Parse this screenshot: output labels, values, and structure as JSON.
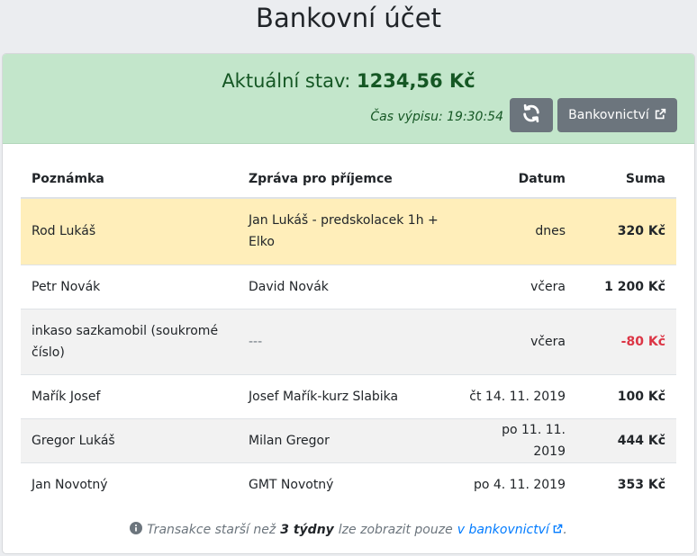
{
  "page": {
    "title": "Bankovní účet"
  },
  "balance": {
    "label": "Aktuální stav:",
    "value": "1234,56 Kč",
    "statement_time": "Čas výpisu: 19:30:54"
  },
  "buttons": {
    "refresh_icon": "refresh-icon",
    "bank_label": "Bankovnictví",
    "bank_icon": "external-link-icon"
  },
  "table": {
    "columns": [
      "Poznámka",
      "Zpráva pro příjemce",
      "Datum",
      "Suma"
    ],
    "rows": [
      {
        "note": "Rod Lukáš",
        "message": "Jan Lukáš - predskolacek 1h + Elko",
        "date": "dnes",
        "amount": "320 Kč",
        "highlight": true,
        "negative": false,
        "muted": false
      },
      {
        "note": "Petr Novák",
        "message": "David Novák",
        "date": "včera",
        "amount": "1 200 Kč",
        "highlight": false,
        "negative": false,
        "muted": false
      },
      {
        "note": "inkaso sazkamobil (soukromé číslo)",
        "message": "---",
        "date": "včera",
        "amount": "-80 Kč",
        "highlight": false,
        "negative": true,
        "muted": true
      },
      {
        "note": "Mařík Josef",
        "message": "Josef Mařík-kurz Slabika",
        "date": "čt 14. 11. 2019",
        "amount": "100 Kč",
        "highlight": false,
        "negative": false,
        "muted": false
      },
      {
        "note": "Gregor Lukáš",
        "message": "Milan Gregor",
        "date": "po 11. 11. 2019",
        "amount": "444 Kč",
        "highlight": false,
        "negative": false,
        "muted": false
      },
      {
        "note": "Jan Novotný",
        "message": "GMT Novotný",
        "date": "po 4. 11. 2019",
        "amount": "353 Kč",
        "highlight": false,
        "negative": false,
        "muted": false
      }
    ]
  },
  "footer": {
    "info_icon": "info-circle-icon",
    "text_before": "Transakce starší než",
    "emphasis": "3 týdny",
    "text_middle": "lze zobrazit pouze",
    "link_text": "v bankovnictví",
    "link_icon": "external-link-icon",
    "text_end": "."
  },
  "colors": {
    "header_bg": "#c3e6cb",
    "header_text": "#155724",
    "highlight_row": "#ffeeba",
    "negative": "#dc3545",
    "button": "#6c757d",
    "link": "#007bff"
  }
}
